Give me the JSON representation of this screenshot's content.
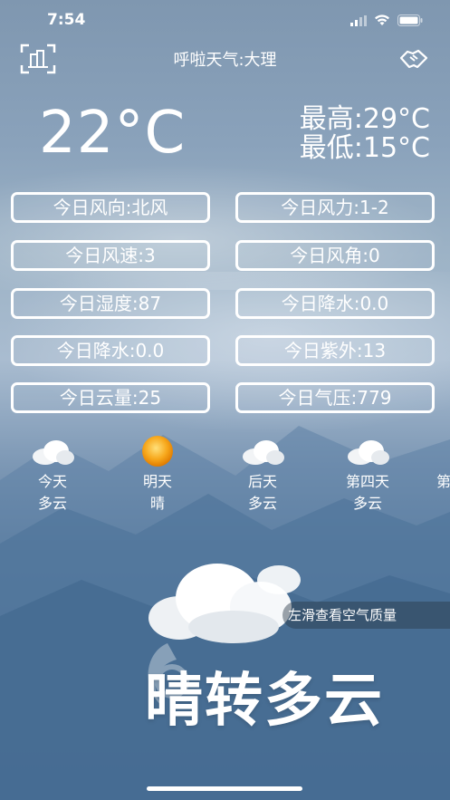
{
  "status_bar": {
    "time": "7:54"
  },
  "navbar": {
    "title": "呼啦天气:大理",
    "left_icon": "city-buildings-icon",
    "right_icon": "handshake-icon"
  },
  "current": {
    "temperature": "22°C",
    "high": "最高:29°C",
    "low": "最低:15°C"
  },
  "details": [
    "今日风向:北风",
    "今日风力:1-2",
    "今日风速:3",
    "今日风角:0",
    "今日湿度:87",
    "今日降水:0.0",
    "今日降水:0.0",
    "今日紫外:13",
    "今日云量:25",
    "今日气压:779"
  ],
  "forecast": [
    {
      "day": "今天",
      "condition": "多云",
      "icon": "cloudy-icon"
    },
    {
      "day": "明天",
      "condition": "晴",
      "icon": "sun-icon"
    },
    {
      "day": "后天",
      "condition": "多云",
      "icon": "cloudy-icon"
    },
    {
      "day": "第四天",
      "condition": "多云",
      "icon": "cloudy-icon"
    },
    {
      "day": "第",
      "condition": "",
      "icon": ""
    }
  ],
  "air_quality_hint": "左滑查看空气质量",
  "condition_text": "晴转多云",
  "colors": {
    "text": "#ffffff",
    "sun": "#f5a623"
  }
}
